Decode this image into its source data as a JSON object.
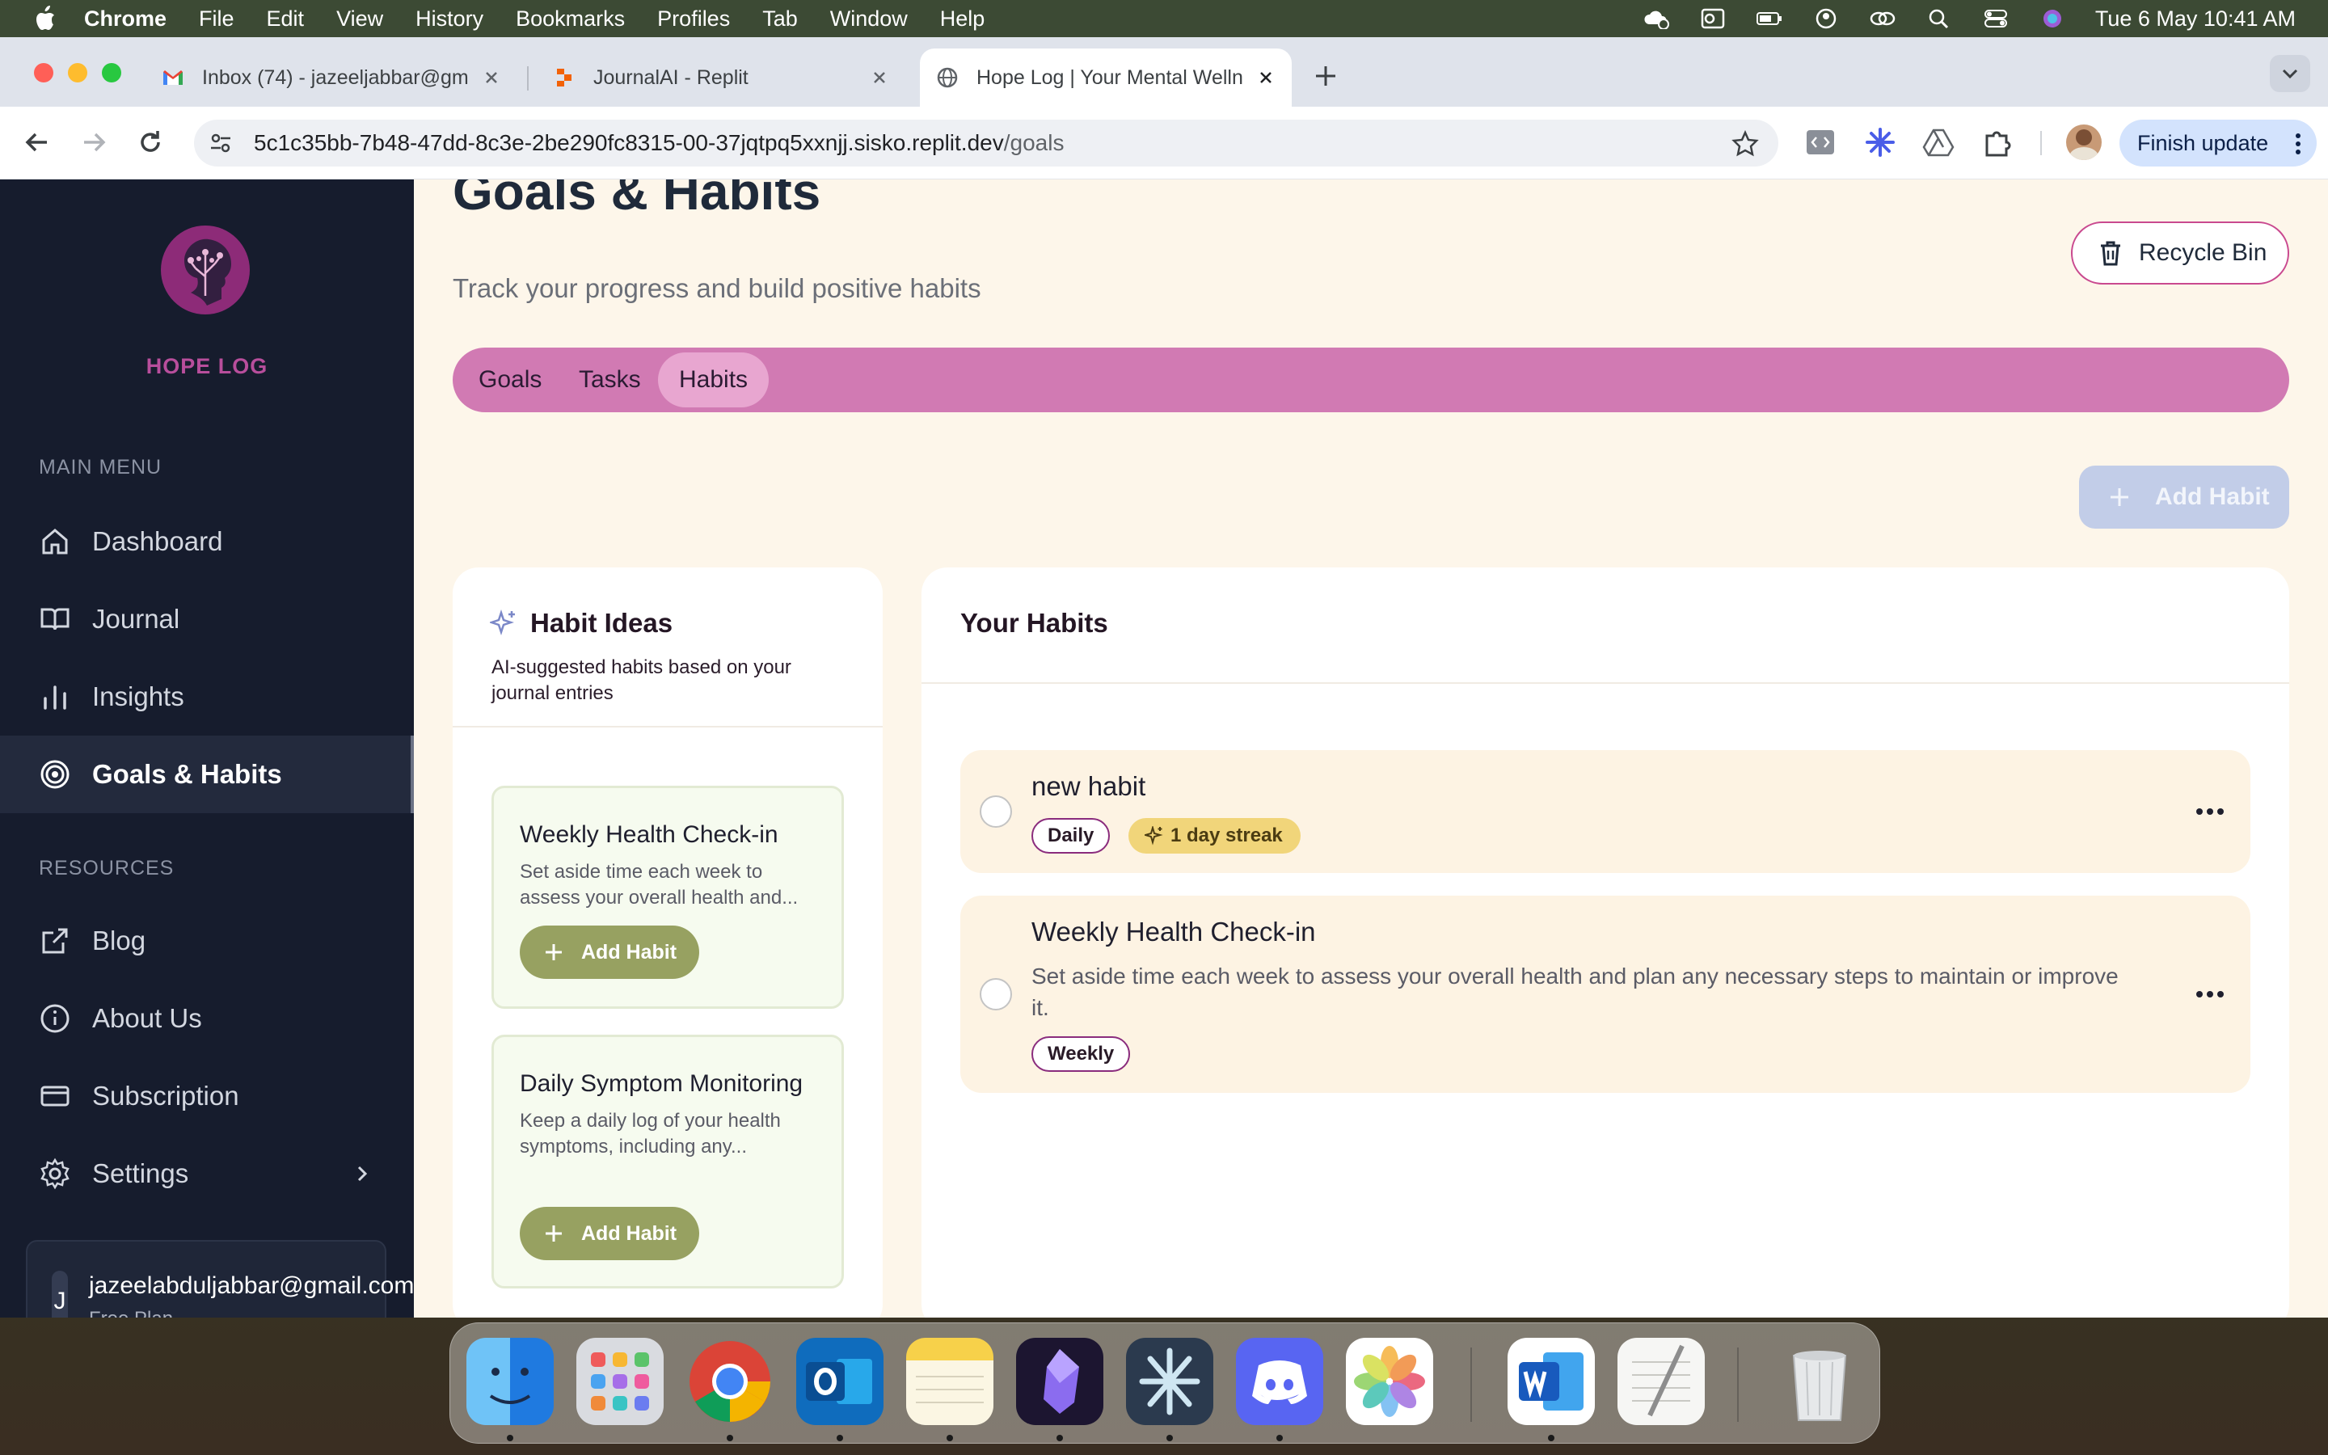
{
  "menubar": {
    "items": [
      "Chrome",
      "File",
      "Edit",
      "View",
      "History",
      "Bookmarks",
      "Profiles",
      "Tab",
      "Window",
      "Help"
    ],
    "clock": "Tue 6 May  10:41 AM"
  },
  "browser": {
    "tabs": [
      {
        "title": "Inbox (74) - jazeeljabbar@gm",
        "icon": "gmail-icon"
      },
      {
        "title": "JournalAI - Replit",
        "icon": "replit-icon"
      },
      {
        "title": "Hope Log | Your Mental Welln",
        "icon": "globe-icon"
      }
    ],
    "url_host": "5c1c35bb-7b48-47dd-8c3e-2be290fc8315-00-37jqtpq5xxnjj.sisko.replit.dev",
    "url_path": "/goals",
    "finish_update": "Finish update"
  },
  "sidebar": {
    "logo_text": "HOPE LOG",
    "main_menu_label": "MAIN MENU",
    "main_items": [
      {
        "label": "Dashboard",
        "icon": "home-icon"
      },
      {
        "label": "Journal",
        "icon": "book-icon"
      },
      {
        "label": "Insights",
        "icon": "bar-chart-icon"
      },
      {
        "label": "Goals & Habits",
        "icon": "target-icon",
        "active": true
      }
    ],
    "resources_label": "RESOURCES",
    "resource_items": [
      {
        "label": "Blog",
        "icon": "external-link-icon"
      },
      {
        "label": "About Us",
        "icon": "info-icon"
      },
      {
        "label": "Subscription",
        "icon": "credit-card-icon"
      },
      {
        "label": "Settings",
        "icon": "gear-icon"
      }
    ],
    "user": {
      "initial": "J",
      "email": "jazeelabduljabbar@gmail.com",
      "plan": "Free Plan"
    }
  },
  "page": {
    "title": "Goals & Habits",
    "subtitle": "Track your progress and build positive habits",
    "recycle_bin": "Recycle Bin",
    "tabs": [
      "Goals",
      "Tasks",
      "Habits"
    ],
    "active_tab": "Habits",
    "add_habit": "Add Habit"
  },
  "ideas": {
    "title": "Habit Ideas",
    "subtitle": "AI-suggested habits based on your journal entries",
    "items": [
      {
        "title": "Weekly Health Check-in",
        "desc": "Set aside time each week to assess your overall health and...",
        "button": "Add Habit"
      },
      {
        "title": "Daily Symptom Monitoring",
        "desc": "Keep a daily log of your health symptoms, including any...",
        "button": "Add Habit"
      }
    ]
  },
  "habits": {
    "title": "Your Habits",
    "items": [
      {
        "name": "new habit",
        "frequency": "Daily",
        "streak": "1 day streak"
      },
      {
        "name": "Weekly Health Check-in",
        "desc": "Set aside time each week to assess your overall health and plan any necessary steps to maintain or improve it.",
        "frequency": "Weekly"
      }
    ]
  },
  "colors": {
    "accent": "#d17ab3",
    "sidebar_bg": "#161c2d",
    "page_bg": "#fdf6ea",
    "olive_button": "#97a161",
    "streak_badge": "#f1d57a"
  },
  "dock": {
    "apps": [
      "finder-icon",
      "launchpad-icon",
      "chrome-icon",
      "outlook-icon",
      "notes-icon",
      "obsidian-icon",
      "perplexity-icon",
      "discord-icon",
      "photos-icon",
      "word-icon",
      "textedit-icon",
      "trash-icon"
    ]
  }
}
